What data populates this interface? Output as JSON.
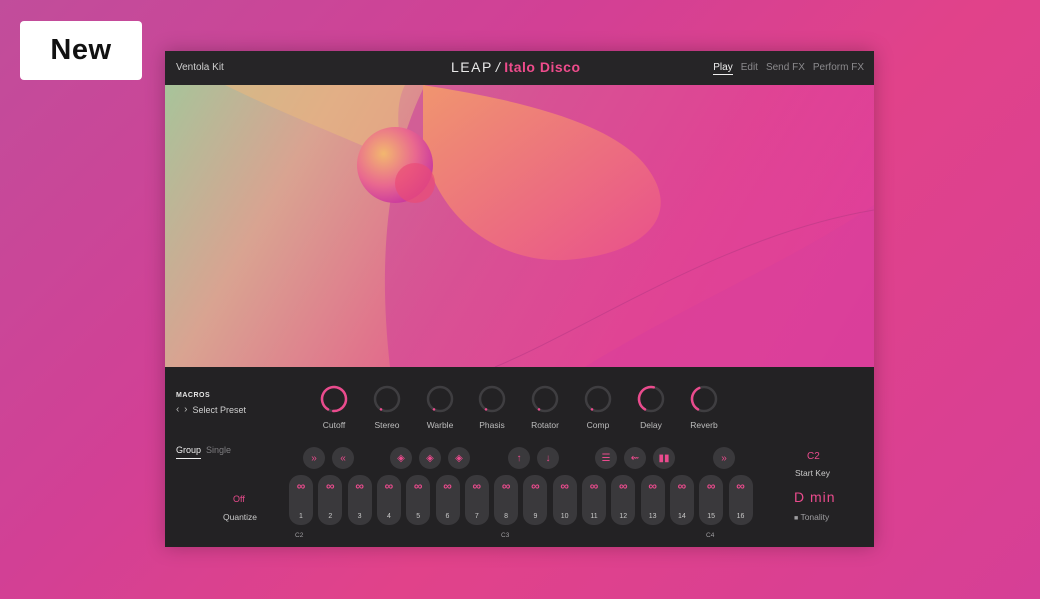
{
  "badge": {
    "label": "New"
  },
  "header": {
    "kit_name": "Ventola Kit",
    "logo_leap": "LEAP",
    "logo_slash": "/",
    "logo_product": "Italo Disco",
    "nav": [
      "Play",
      "Edit",
      "Send FX",
      "Perform FX"
    ],
    "nav_active": "Play"
  },
  "macros": {
    "label": "MACROS",
    "preset_label": "Select Preset",
    "knobs": [
      {
        "label": "Cutoff",
        "value": 0.92
      },
      {
        "label": "Stereo",
        "value": 0.0
      },
      {
        "label": "Warble",
        "value": 0.0
      },
      {
        "label": "Phasis",
        "value": 0.0
      },
      {
        "label": "Rotator",
        "value": 0.0
      },
      {
        "label": "Comp",
        "value": 0.0
      },
      {
        "label": "Delay",
        "value": 0.45
      },
      {
        "label": "Reverb",
        "value": 0.35
      }
    ]
  },
  "perform": {
    "mode_group": "Group",
    "mode_single": "Single",
    "quantize_value": "Off",
    "quantize_label": "Quantize",
    "pad_numbers": [
      "1",
      "2",
      "3",
      "4",
      "5",
      "6",
      "7",
      "8",
      "9",
      "10",
      "11",
      "12",
      "13",
      "14",
      "15",
      "16"
    ],
    "note_labels": {
      "c2": "C2",
      "c3": "C3",
      "c4": "C4"
    },
    "start_key_value": "C2",
    "start_key_label": "Start Key",
    "tonality_value": "D  min",
    "tonality_label": "Tonality"
  },
  "colors": {
    "accent": "#ea4b8d",
    "panel": "#232224",
    "button": "#3a393c"
  }
}
